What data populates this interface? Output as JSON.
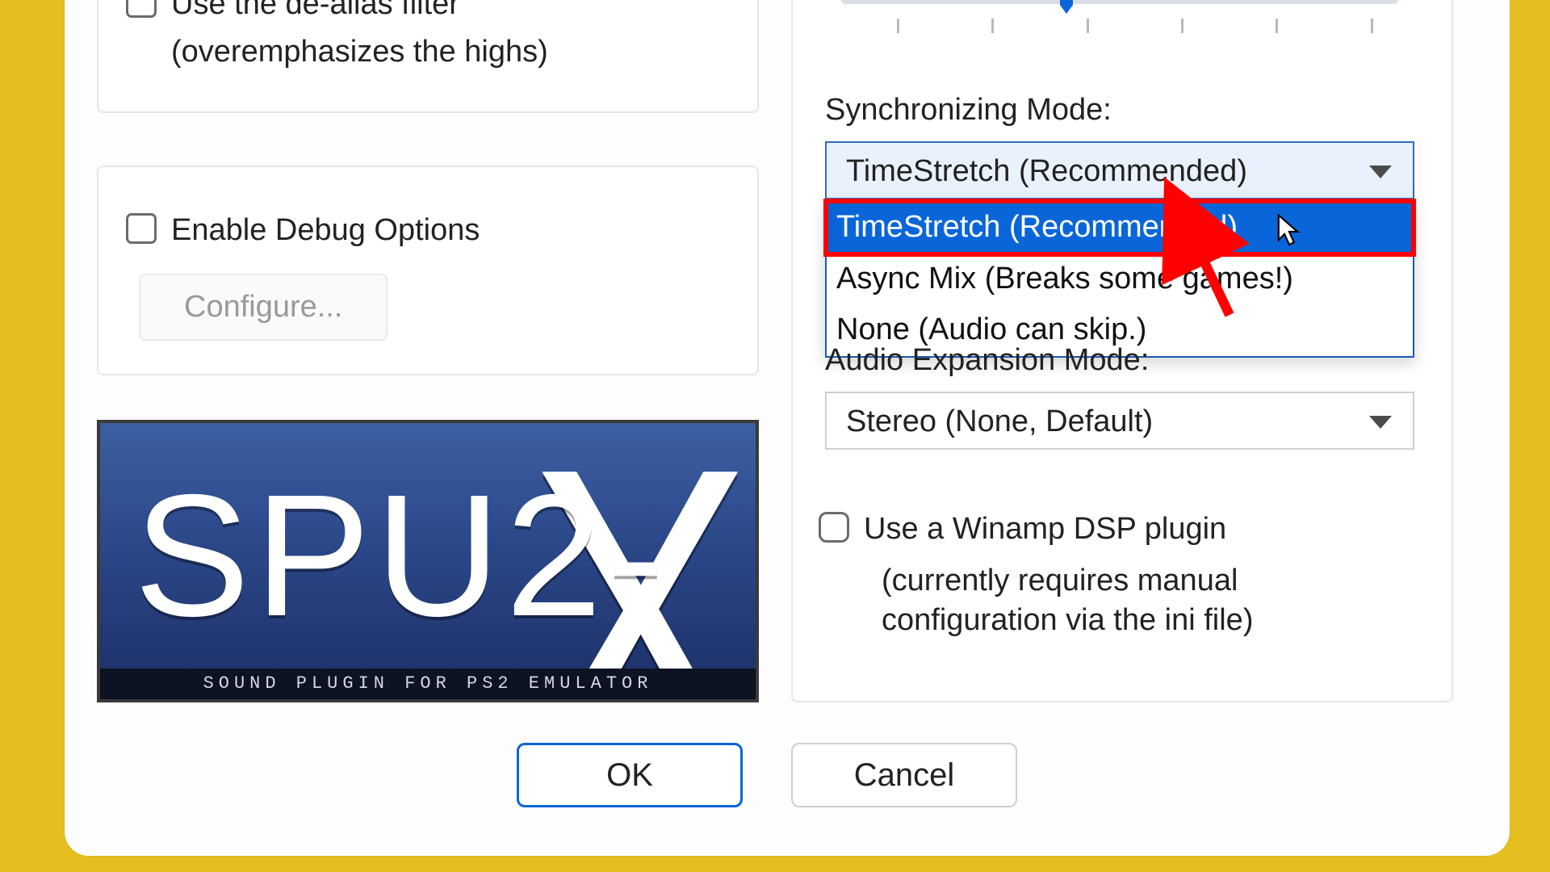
{
  "left": {
    "dealias": {
      "label": "Use the de-alias filter",
      "sub": "(overemphasizes the highs)"
    },
    "debug": {
      "label": "Enable Debug Options",
      "configure": "Configure..."
    },
    "logo": {
      "main": "SPU2-",
      "x": "X",
      "sub": "SOUND PLUGIN FOR PS2 EMULATOR"
    }
  },
  "right": {
    "sync_label": "Synchronizing Mode:",
    "sync_selected": "TimeStretch (Recommended)",
    "sync_options": [
      "TimeStretch (Recommended)",
      "Async Mix (Breaks some games!)",
      "None (Audio can skip.)"
    ],
    "audio_label": "Audio Expansion Mode:",
    "audio_selected": "Stereo (None, Default)",
    "winamp": {
      "label": "Use a Winamp DSP plugin",
      "sub": "(currently requires manual configuration via the ini file)"
    }
  },
  "buttons": {
    "ok": "OK",
    "cancel": "Cancel"
  }
}
